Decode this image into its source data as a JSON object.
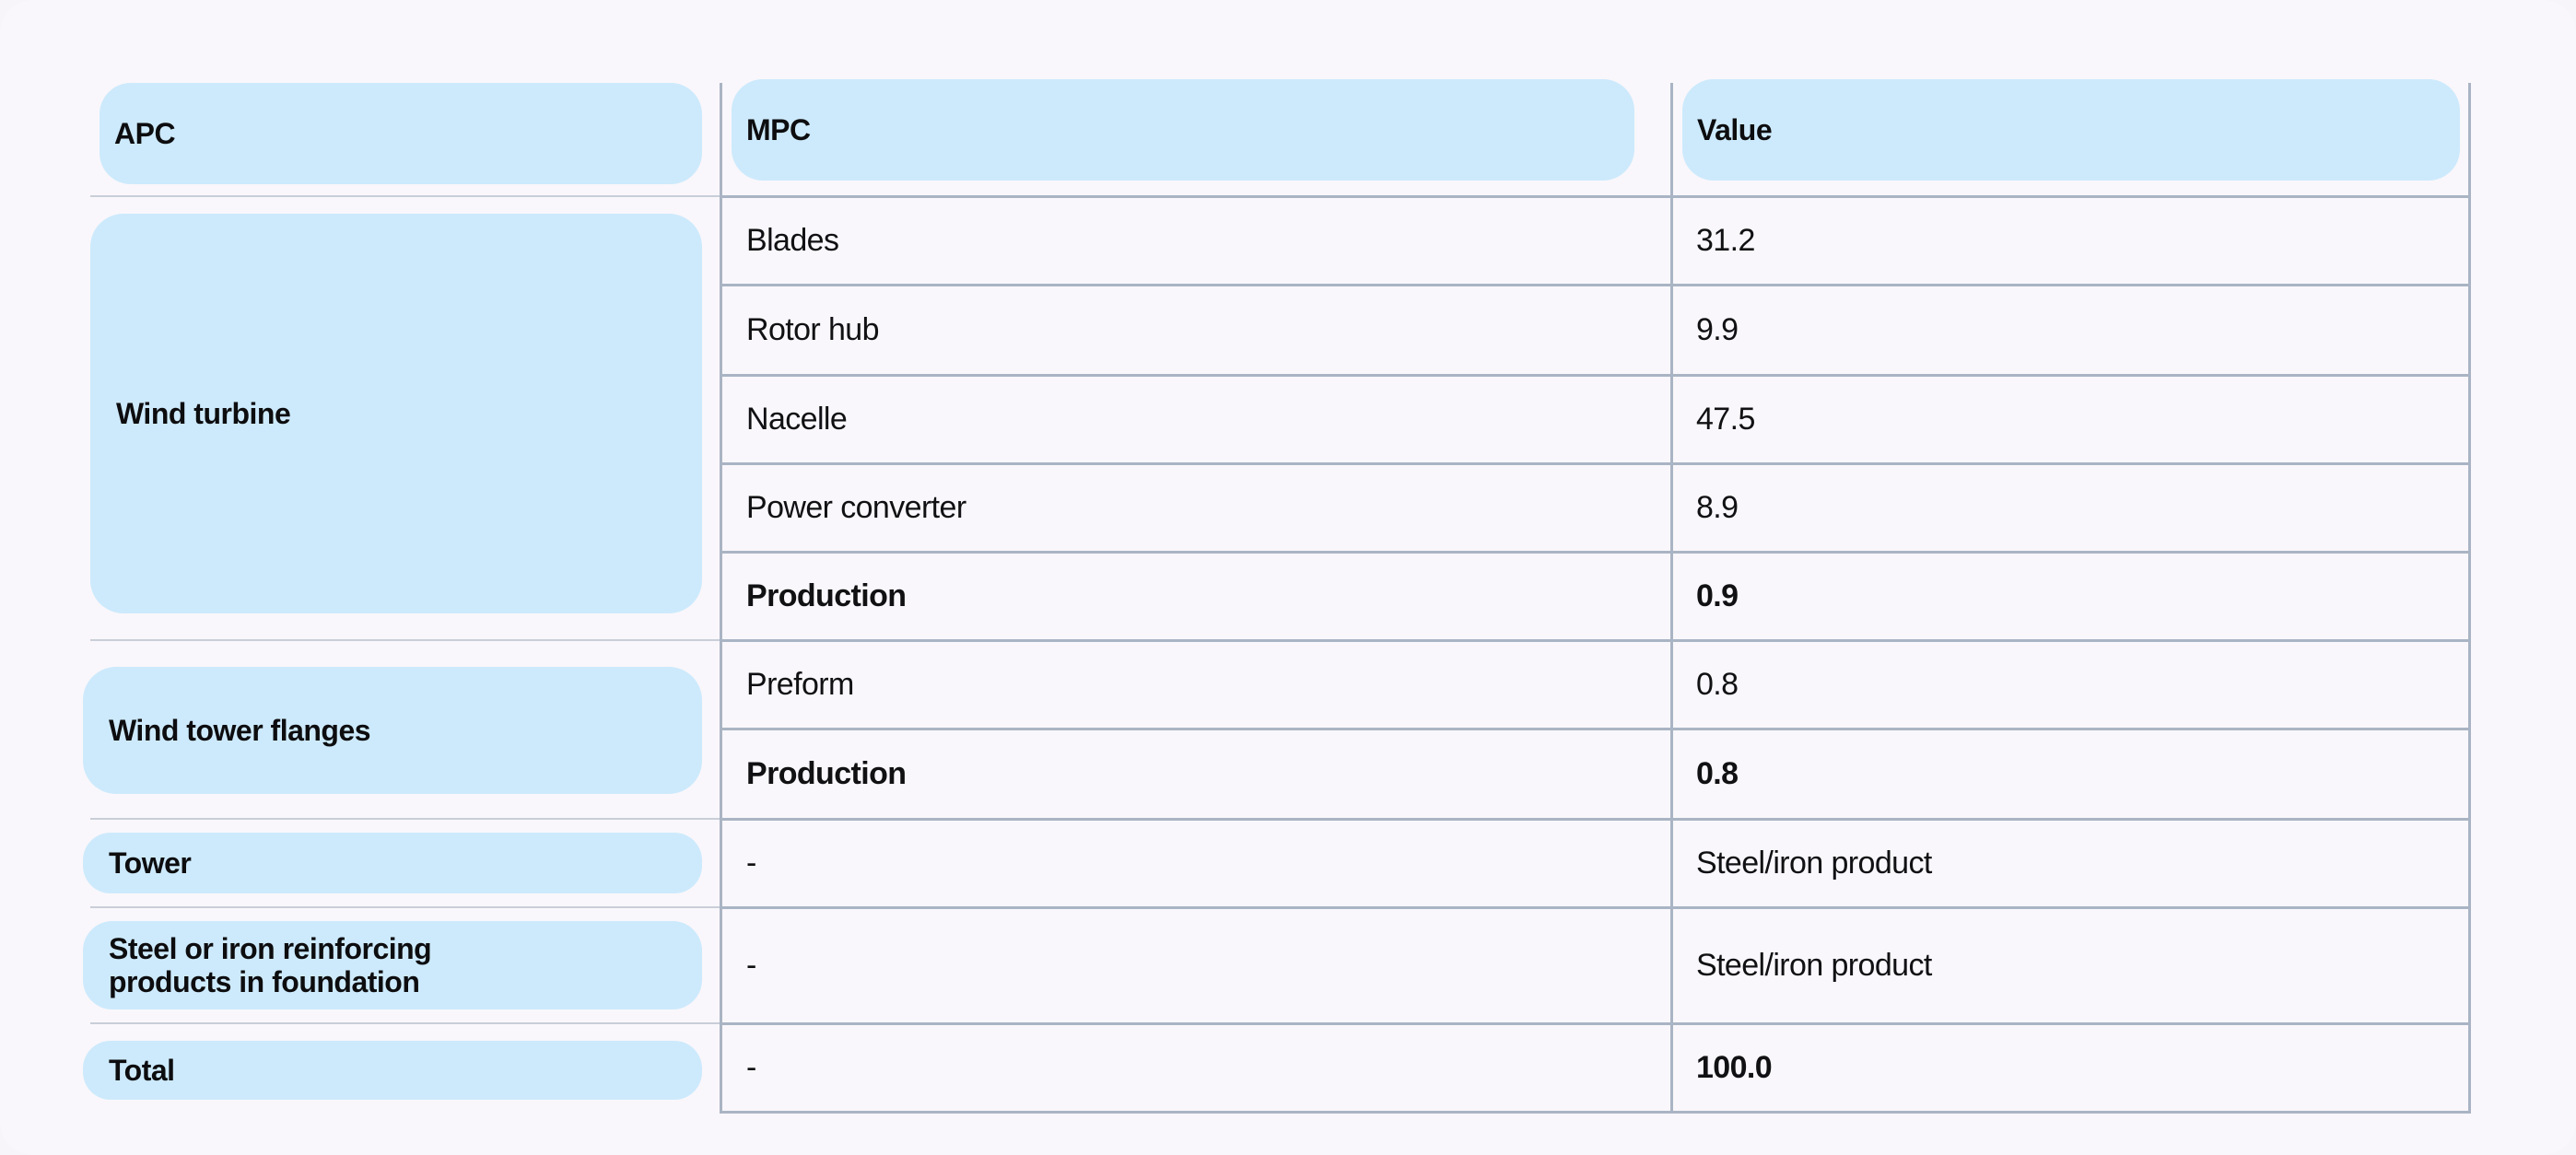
{
  "table": {
    "headers": {
      "apc": "APC",
      "mpc": "MPC",
      "value": "Value"
    },
    "groups": [
      {
        "apc": "Wind turbine",
        "rows": [
          {
            "mpc": "Blades",
            "value": "31.2",
            "bold": false
          },
          {
            "mpc": "Rotor hub",
            "value": "9.9",
            "bold": false
          },
          {
            "mpc": "Nacelle",
            "value": "47.5",
            "bold": false
          },
          {
            "mpc": "Power converter",
            "value": "8.9",
            "bold": false
          },
          {
            "mpc": "Production",
            "value": "0.9",
            "bold": true
          }
        ]
      },
      {
        "apc": "Wind tower flanges",
        "rows": [
          {
            "mpc": "Preform",
            "value": "0.8",
            "bold": false
          },
          {
            "mpc": "Production",
            "value": "0.8",
            "bold": true
          }
        ]
      },
      {
        "apc": "Tower",
        "rows": [
          {
            "mpc": "-",
            "value": "Steel/iron product",
            "bold": false
          }
        ]
      },
      {
        "apc_line1": "Steel or iron reinforcing",
        "apc_line2": "products in foundation",
        "rows": [
          {
            "mpc": "-",
            "value": "Steel/iron product",
            "bold": false
          }
        ]
      },
      {
        "apc": "Total",
        "rows": [
          {
            "mpc": "-",
            "value": "100.0",
            "bold": true
          }
        ]
      }
    ]
  },
  "colors": {
    "pill": "#cdeafc",
    "grid": "#a9b4c4",
    "background": "#f9f7fb"
  }
}
